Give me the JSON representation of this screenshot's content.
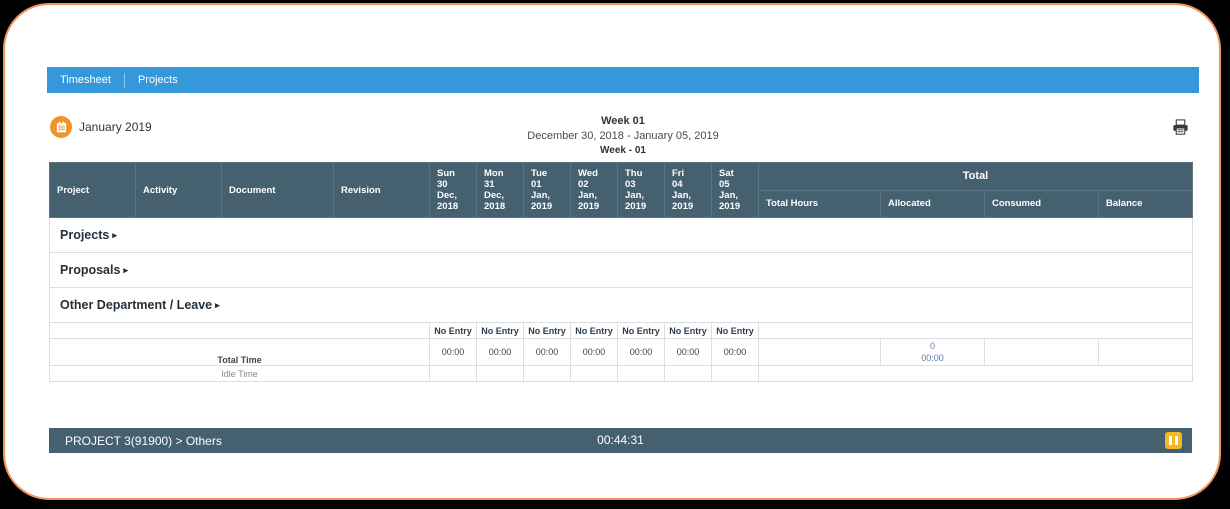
{
  "navbar": {
    "items": [
      {
        "label": "Timesheet"
      },
      {
        "label": "Projects"
      }
    ]
  },
  "header": {
    "calendar_icon": "calendar-icon",
    "month_label": "January 2019",
    "week_title": "Week 01",
    "week_range": "December 30, 2018 - January 05, 2019",
    "week_sub": "Week - 01",
    "print_icon": "printer-icon"
  },
  "table": {
    "columns": [
      {
        "label": "Project"
      },
      {
        "label": "Activity"
      },
      {
        "label": "Document"
      },
      {
        "label": "Revision"
      }
    ],
    "days": [
      {
        "dow": "Sun",
        "date": "30 Dec,",
        "year": "2018"
      },
      {
        "dow": "Mon",
        "date": "31 Dec,",
        "year": "2018"
      },
      {
        "dow": "Tue",
        "date": "01 Jan,",
        "year": "2019"
      },
      {
        "dow": "Wed",
        "date": "02 Jan,",
        "year": "2019"
      },
      {
        "dow": "Thu",
        "date": "03 Jan,",
        "year": "2019"
      },
      {
        "dow": "Fri",
        "date": "04 Jan,",
        "year": "2019"
      },
      {
        "dow": "Sat",
        "date": "05 Jan,",
        "year": "2019"
      }
    ],
    "total_group_label": "Total",
    "total_columns": [
      {
        "label": "Total Hours"
      },
      {
        "label": "Allocated"
      },
      {
        "label": "Consumed"
      },
      {
        "label": "Balance"
      }
    ],
    "groups": [
      {
        "label": "Projects",
        "caret": "▸"
      },
      {
        "label": "Proposals",
        "caret": "▸"
      },
      {
        "label": "Other Department / Leave",
        "caret": "▸"
      }
    ],
    "no_entry_cells": [
      "No Entry",
      "No Entry",
      "No Entry",
      "No Entry",
      "No Entry",
      "No Entry",
      "No Entry"
    ],
    "day_times": [
      "00:00",
      "00:00",
      "00:00",
      "00:00",
      "00:00",
      "00:00",
      "00:00"
    ],
    "total_time_label": "Total Time",
    "idle_time_label": "Idle Time",
    "totals": {
      "total_hours": "",
      "allocated": "0",
      "allocated_time": "00:00",
      "consumed": "",
      "balance": ""
    }
  },
  "statusbar": {
    "task": "PROJECT 3(91900) > Others",
    "timer": "00:44:31",
    "pause_icon": "pause-icon"
  },
  "colors": {
    "nav_blue": "#3498db",
    "header_slate": "#45606f",
    "accent_orange": "#f0932b",
    "frame_orange": "#f0935a",
    "pause_yellow": "#f5b824",
    "total_value_blue": "#5b7fa6"
  }
}
